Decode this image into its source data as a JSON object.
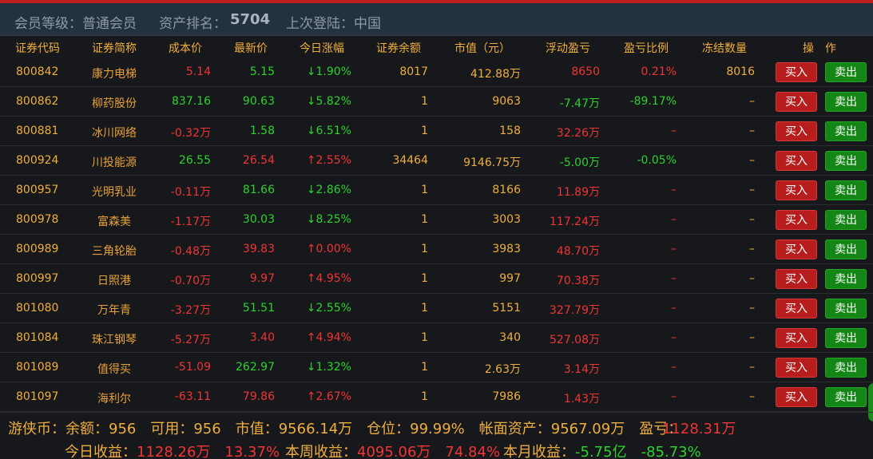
{
  "header": {
    "level_label": "会员等级：普通会员",
    "rank_label": "资产排名：",
    "rank_value": "5704",
    "last_login_label": "上次登陆：中国"
  },
  "columns": [
    "证券代码",
    "证券简称",
    "成本价",
    "最新价",
    "今日涨幅",
    "证券余额",
    "市值（元）",
    "浮动盈亏",
    "盈亏比例",
    "冻结数量",
    "操",
    "作"
  ],
  "buy_label": "买入",
  "sell_label": "卖出",
  "colors": {
    "up": "#f03535",
    "down": "#2ed12e",
    "neutral": "#f0ae3e",
    "buy": "#b71d1d",
    "sell": "#148616"
  },
  "rows": [
    {
      "code": "800842",
      "name": "康力电梯",
      "cost": "5.14",
      "cost_c": "red",
      "price": "5.15",
      "price_c": "green",
      "change": "↓1.90%",
      "change_c": "green",
      "balance": "8017",
      "value": "412.88万",
      "pnl": "8650",
      "pnl_c": "red",
      "ratio": "0.21%",
      "ratio_c": "red",
      "frozen": "8016"
    },
    {
      "code": "800862",
      "name": "柳药股份",
      "cost": "837.16",
      "cost_c": "green",
      "price": "90.63",
      "price_c": "green",
      "change": "↓5.82%",
      "change_c": "green",
      "balance": "1",
      "value": "9063",
      "pnl": "-7.47万",
      "pnl_c": "green",
      "ratio": "-89.17%",
      "ratio_c": "green",
      "frozen": "–"
    },
    {
      "code": "800881",
      "name": "冰川网络",
      "cost": "-0.32万",
      "cost_c": "red",
      "price": "1.58",
      "price_c": "green",
      "change": "↓6.51%",
      "change_c": "green",
      "balance": "1",
      "value": "158",
      "pnl": "32.26万",
      "pnl_c": "red",
      "ratio": "–",
      "ratio_c": "red",
      "frozen": "–"
    },
    {
      "code": "800924",
      "name": "川投能源",
      "cost": "26.55",
      "cost_c": "green",
      "price": "26.54",
      "price_c": "red",
      "change": "↑2.55%",
      "change_c": "red",
      "balance": "34464",
      "value": "9146.75万",
      "pnl": "-5.00万",
      "pnl_c": "green",
      "ratio": "-0.05%",
      "ratio_c": "green",
      "frozen": "–"
    },
    {
      "code": "800957",
      "name": "光明乳业",
      "cost": "-0.11万",
      "cost_c": "red",
      "price": "81.66",
      "price_c": "green",
      "change": "↓2.86%",
      "change_c": "green",
      "balance": "1",
      "value": "8166",
      "pnl": "11.89万",
      "pnl_c": "red",
      "ratio": "–",
      "ratio_c": "red",
      "frozen": "–"
    },
    {
      "code": "800978",
      "name": "富森美",
      "cost": "-1.17万",
      "cost_c": "red",
      "price": "30.03",
      "price_c": "green",
      "change": "↓8.25%",
      "change_c": "green",
      "balance": "1",
      "value": "3003",
      "pnl": "117.24万",
      "pnl_c": "red",
      "ratio": "–",
      "ratio_c": "red",
      "frozen": "–"
    },
    {
      "code": "800989",
      "name": "三角轮胎",
      "cost": "-0.48万",
      "cost_c": "red",
      "price": "39.83",
      "price_c": "red",
      "change": "↑0.00%",
      "change_c": "red",
      "balance": "1",
      "value": "3983",
      "pnl": "48.70万",
      "pnl_c": "red",
      "ratio": "–",
      "ratio_c": "red",
      "frozen": "–"
    },
    {
      "code": "800997",
      "name": "日照港",
      "cost": "-0.70万",
      "cost_c": "red",
      "price": "9.97",
      "price_c": "red",
      "change": "↑4.95%",
      "change_c": "red",
      "balance": "1",
      "value": "997",
      "pnl": "70.38万",
      "pnl_c": "red",
      "ratio": "–",
      "ratio_c": "red",
      "frozen": "–"
    },
    {
      "code": "801080",
      "name": "万年青",
      "cost": "-3.27万",
      "cost_c": "red",
      "price": "51.51",
      "price_c": "green",
      "change": "↓2.55%",
      "change_c": "green",
      "balance": "1",
      "value": "5151",
      "pnl": "327.79万",
      "pnl_c": "red",
      "ratio": "–",
      "ratio_c": "red",
      "frozen": "–"
    },
    {
      "code": "801084",
      "name": "珠江钢琴",
      "cost": "-5.27万",
      "cost_c": "red",
      "price": "3.40",
      "price_c": "red",
      "change": "↑4.94%",
      "change_c": "red",
      "balance": "1",
      "value": "340",
      "pnl": "527.08万",
      "pnl_c": "red",
      "ratio": "–",
      "ratio_c": "red",
      "frozen": "–"
    },
    {
      "code": "801089",
      "name": "值得买",
      "cost": "-51.09",
      "cost_c": "red",
      "price": "262.97",
      "price_c": "green",
      "change": "↓1.32%",
      "change_c": "green",
      "balance": "1",
      "value": "2.63万",
      "pnl": "3.14万",
      "pnl_c": "red",
      "ratio": "–",
      "ratio_c": "red",
      "frozen": "–"
    },
    {
      "code": "801097",
      "name": "海利尔",
      "cost": "-63.11",
      "cost_c": "red",
      "price": "79.86",
      "price_c": "red",
      "change": "↑2.67%",
      "change_c": "red",
      "balance": "1",
      "value": "7986",
      "pnl": "1.43万",
      "pnl_c": "red",
      "ratio": "–",
      "ratio_c": "red",
      "frozen": "–"
    }
  ],
  "footer": {
    "coin_label": "游侠币：余额：956　可用：956　市值：9566.14万　仓位：99.99%　帐面资产：9567.09万　盈亏：",
    "pnl_total": "1128.31万",
    "today_label": "今日收益：",
    "today_value": "1128.26万　13.37%",
    "week_label": "本周收益：",
    "week_value": "4095.06万　74.84%",
    "month_label": "本月收益：",
    "month_value": "-5.75亿　-85.73%"
  }
}
